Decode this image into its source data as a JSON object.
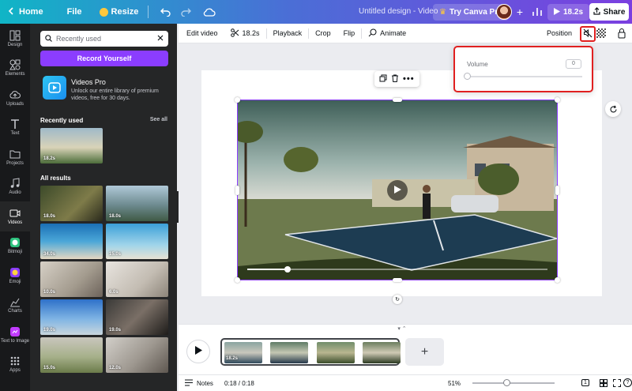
{
  "topbar": {
    "home_label": "Home",
    "file_label": "File",
    "resize_label": "Resize",
    "title": "Untitled design - Video",
    "pro_label": "Try Canva Pro",
    "play_label": "18.2s",
    "share_label": "Share"
  },
  "rail": [
    {
      "label": "Design",
      "icon": "design-icon"
    },
    {
      "label": "Elements",
      "icon": "elements-icon"
    },
    {
      "label": "Uploads",
      "icon": "upload-icon"
    },
    {
      "label": "Text",
      "icon": "text-icon"
    },
    {
      "label": "Projects",
      "icon": "folder-icon"
    },
    {
      "label": "Audio",
      "icon": "audio-icon"
    },
    {
      "label": "Videos",
      "icon": "video-icon"
    },
    {
      "label": "Bitmoji",
      "icon": "bitmoji-icon"
    },
    {
      "label": "Emoji",
      "icon": "emoji-icon"
    },
    {
      "label": "Charts",
      "icon": "chart-icon"
    },
    {
      "label": "Text to Image",
      "icon": "text-to-image-icon"
    },
    {
      "label": "Apps",
      "icon": "apps-icon"
    }
  ],
  "panel": {
    "search_placeholder": "Recently used",
    "record_label": "Record Yourself",
    "videos_pro_title": "Videos Pro",
    "videos_pro_desc": "Unlock our entire library of premium videos, free for 30 days.",
    "recent_heading": "Recently used",
    "see_all": "See all",
    "recent_duration": "18.2s",
    "results_heading": "All results",
    "results": [
      "18.0s",
      "18.0s",
      "34.0s",
      "15.0s",
      "10.0s",
      "6.0s",
      "19.0s",
      "19.0s",
      "15.0s",
      "12.0s"
    ]
  },
  "toolbar": {
    "edit_video": "Edit video",
    "duration": "18.2s",
    "playback": "Playback",
    "crop": "Crop",
    "flip": "Flip",
    "animate": "Animate",
    "position": "Position"
  },
  "volume": {
    "label": "Volume",
    "value": "0"
  },
  "timeline": {
    "clip_duration": "18.2s"
  },
  "bottombar": {
    "notes": "Notes",
    "time": "0:18 / 0:18",
    "zoom": "51%",
    "page_count": "1"
  },
  "colors": {
    "accent": "#8b3dff",
    "highlight": "#e02020"
  }
}
